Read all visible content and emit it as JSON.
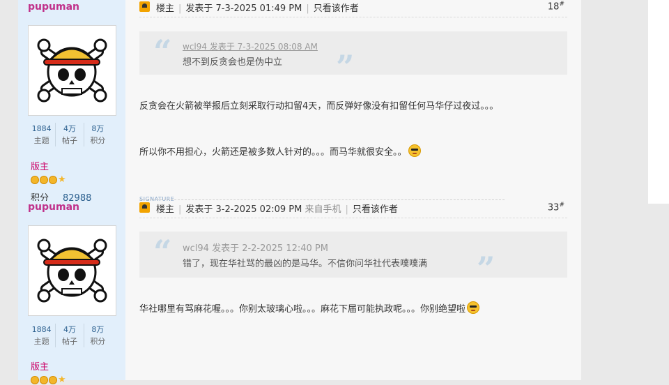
{
  "posts": [
    {
      "username": "pupuman",
      "stats": [
        {
          "value": "1884",
          "label": "主题"
        },
        {
          "value": "4万",
          "label": "帖子"
        },
        {
          "value": "8万",
          "label": "积分"
        }
      ],
      "rank": "版主",
      "score_label": "积分",
      "score_value": "82988",
      "owner_label": "楼主",
      "posted_at": "发表于 7-3-2025 01:49 PM",
      "source": "",
      "only_author": "只看该作者",
      "floor": "18",
      "floor_sup": "#",
      "quote": {
        "author_line": "wcl94 发表于 7-3-2025 08:08 AM",
        "text": "想不到反贪会也是伪中立"
      },
      "lines": [
        "反贪会在火箭被举报后立刻采取行动扣留4天，而反弹好像没有扣留任何马华仔过夜过。。。",
        "所以你不用担心，火箭还是被多数人针对的。。。而马华就很安全。。"
      ],
      "signature_label": "SIGNATURE"
    },
    {
      "username": "pupuman",
      "stats": [
        {
          "value": "1884",
          "label": "主题"
        },
        {
          "value": "4万",
          "label": "帖子"
        },
        {
          "value": "8万",
          "label": "积分"
        }
      ],
      "rank": "版主",
      "owner_label": "楼主",
      "posted_at": "发表于 3-2-2025 02:09 PM",
      "source": "来自手机",
      "only_author": "只看该作者",
      "floor": "33",
      "floor_sup": "#",
      "quote": {
        "author_line": "wcl94 发表于 2-2-2025 12:40 PM",
        "text": "错了，现在华社骂的最凶的是马华。不信你问华社代表噗噗满"
      },
      "lines": [
        "华社哪里有骂麻花喔。。。你别太玻璃心啦。。。麻花下届可能执政呢。。。你别绝望啦"
      ]
    }
  ]
}
